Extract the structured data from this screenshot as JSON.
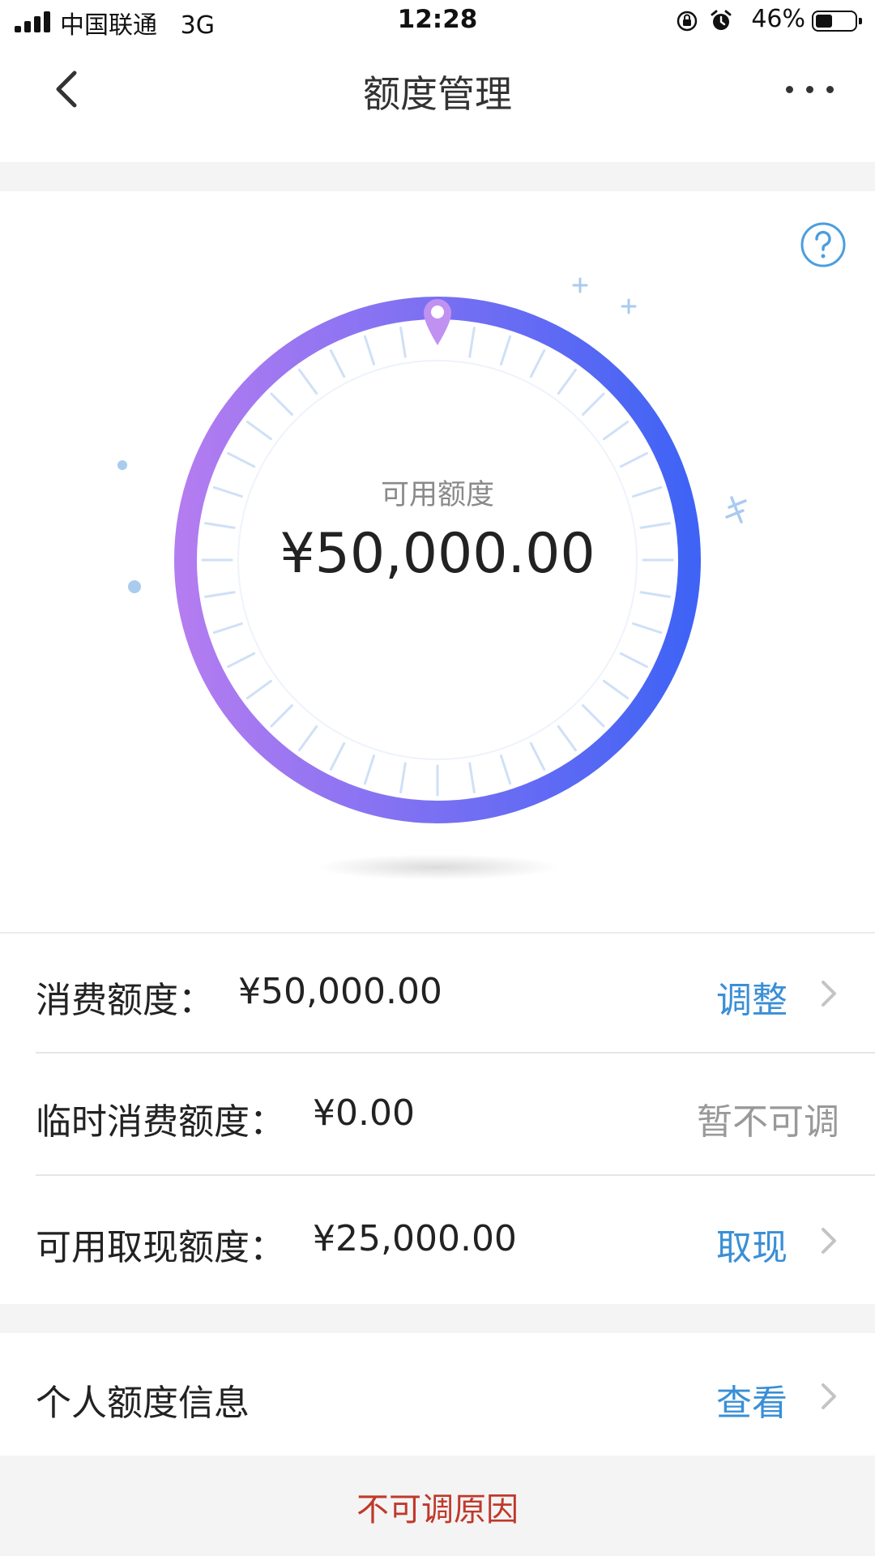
{
  "status_bar": {
    "carrier": "中国联通   3G",
    "time": "12:28",
    "battery": "46%",
    "battery_level": 0.46,
    "icons": [
      "signal-icon",
      "orientation-lock-icon",
      "alarm-icon",
      "battery-icon"
    ]
  },
  "navbar": {
    "title": "额度管理",
    "back_icon": "chevron-left-icon",
    "more_icon": "more-dots-icon"
  },
  "hero": {
    "help_icon": "question-circle-icon",
    "label": "可用额度",
    "amount": "¥50,000.00"
  },
  "limits": [
    {
      "label": "消费额度：",
      "value": "¥50,000.00",
      "action": "调整",
      "actionable": true
    },
    {
      "label": "临时消费额度：",
      "value": "¥0.00",
      "action": "暂不可调",
      "actionable": false
    },
    {
      "label": "可用取现额度：",
      "value": "¥25,000.00",
      "action": "取现",
      "actionable": true
    }
  ],
  "personal": {
    "label": "个人额度信息",
    "action": "查看"
  },
  "footer": {
    "link": "不可调原因"
  },
  "colors": {
    "accent": "#3a8fd6",
    "dial_start": "#b37cf0",
    "dial_end": "#3f63f5",
    "warning_text": "#c0392b"
  }
}
